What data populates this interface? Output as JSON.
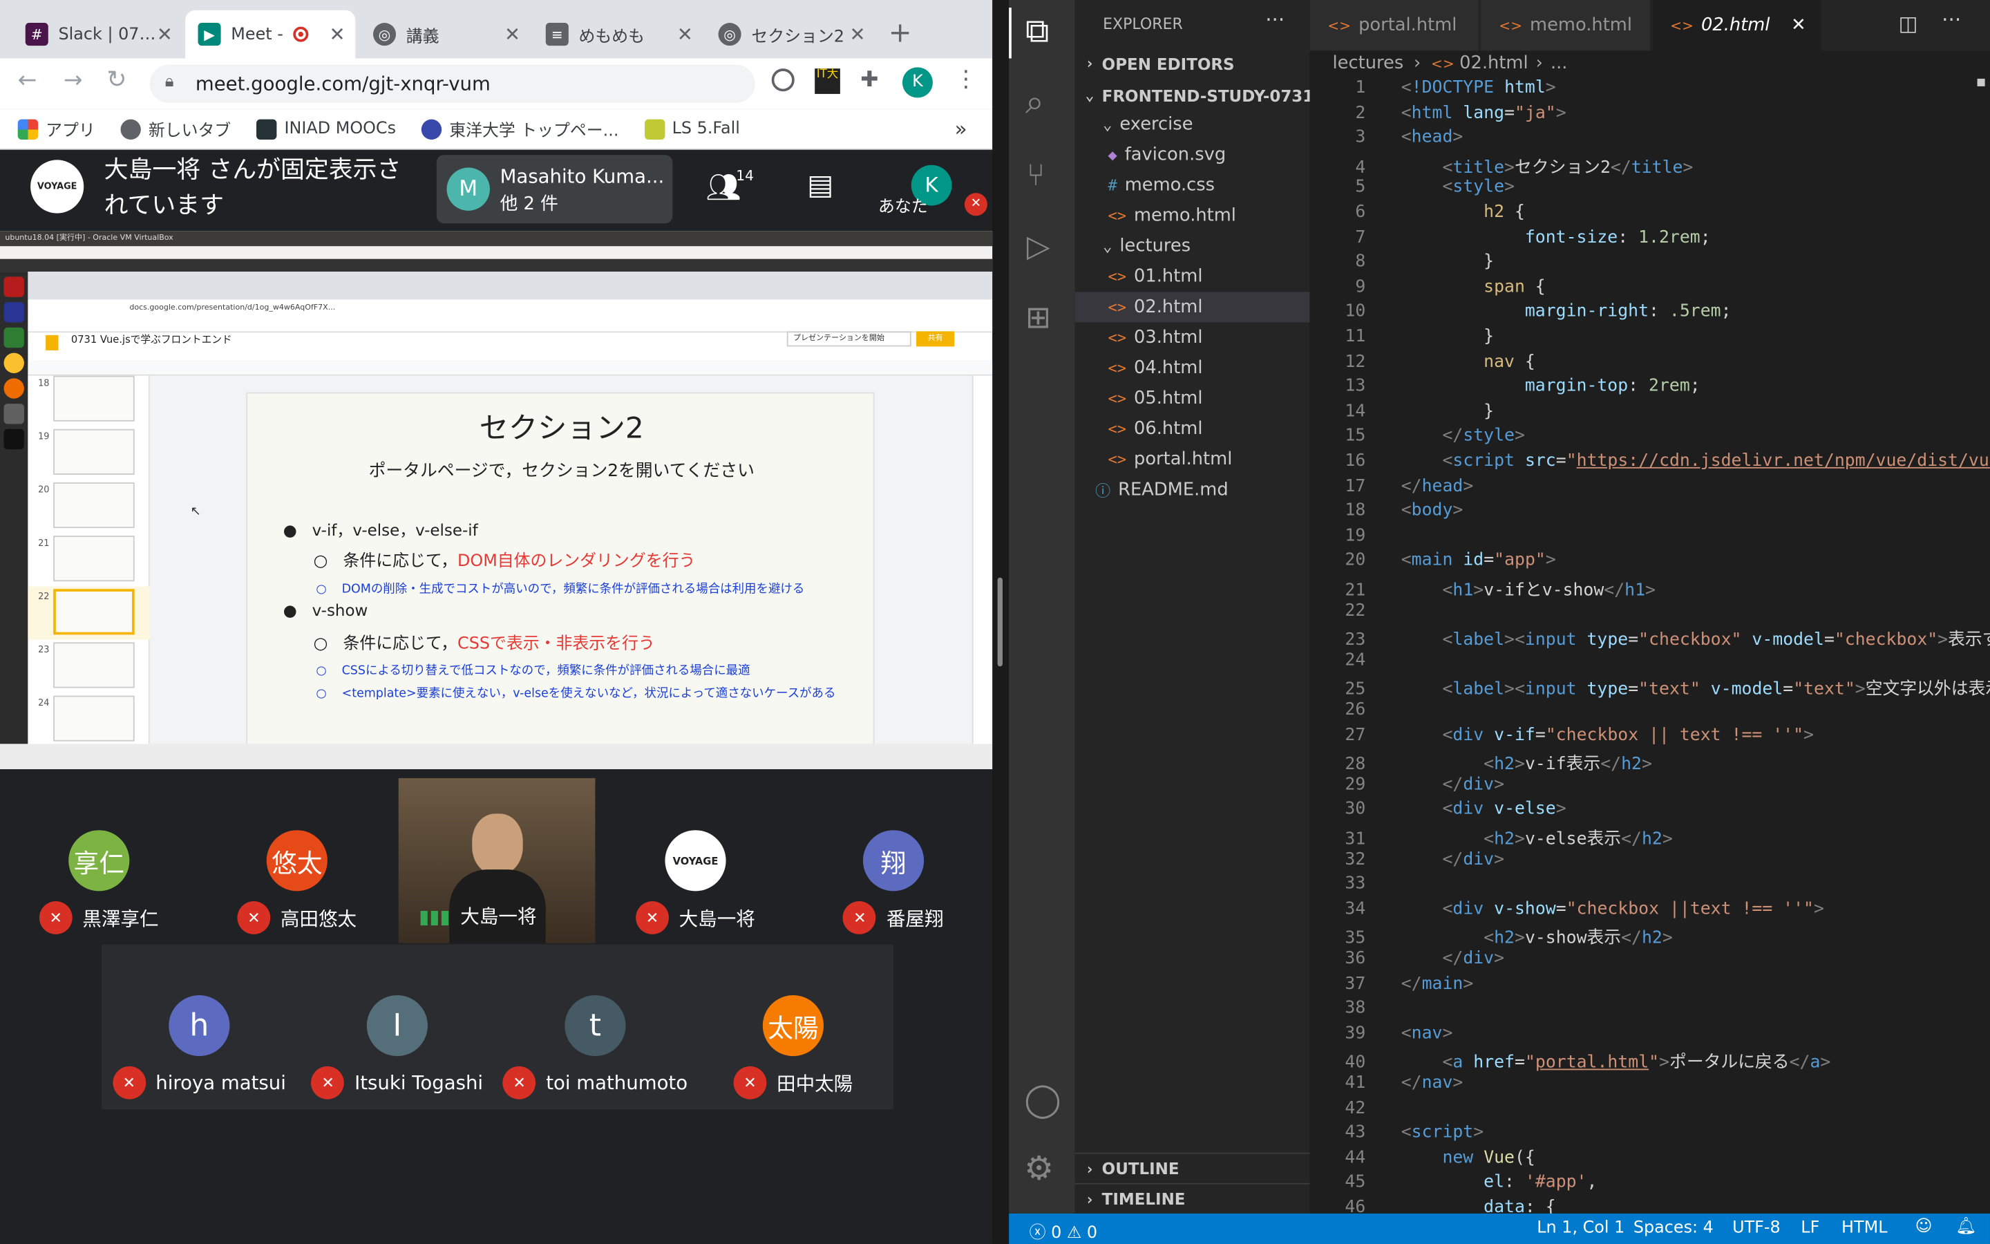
{
  "chrome": {
    "tabs": [
      {
        "label": "Slack | 07…"
      },
      {
        "label": "Meet -"
      },
      {
        "label": "講義"
      },
      {
        "label": "めもめも"
      },
      {
        "label": "セクション2"
      }
    ],
    "new_tab": "+",
    "url": "meet.google.com/gjt-xnqr-vum",
    "bookmarks": [
      {
        "label": "アプリ"
      },
      {
        "label": "新しいタブ"
      },
      {
        "label": "INIAD MOOCs"
      },
      {
        "label": "東洋大学 トップペー..."
      },
      {
        "label": "LS 5.Fall"
      }
    ],
    "more": "»"
  },
  "meet": {
    "pinned_text": "大島一将 さんが固定表示されています",
    "presenter_name": "Masahito Kuma...",
    "presenter_extra": "他 2 件",
    "people_count": "14",
    "self_label": "あなた",
    "self_initial": "K",
    "presenter_initial": "M",
    "participants_row1": [
      {
        "initial": "享仁",
        "name": "黒澤享仁",
        "color": "#7cb342"
      },
      {
        "initial": "悠太",
        "name": "高田悠太",
        "color": "#e64a19"
      },
      {
        "initial": "",
        "name": "大島一将",
        "video": true
      },
      {
        "initial": "VOYAGE",
        "name": "大島一将",
        "color": "#ffffff"
      },
      {
        "initial": "翔",
        "name": "番屋翔",
        "color": "#5c6bc0"
      }
    ],
    "participants_row2": [
      {
        "initial": "h",
        "name": "hiroya matsui",
        "color": "#5c6bc0"
      },
      {
        "initial": "I",
        "name": "Itsuki Togashi",
        "color": "#546e7a"
      },
      {
        "initial": "t",
        "name": "toi mathumoto",
        "color": "#455a64"
      },
      {
        "initial": "太陽",
        "name": "田中太陽",
        "color": "#f57c00"
      }
    ]
  },
  "slide": {
    "vm_title": "ubuntu18.04 [実行中] - Oracle VM VirtualBox",
    "doc_title": "0731 Vue.jsで学ぶフロントエンド",
    "url": "docs.google.com/presentation/d/1og_w4w6AqOfF7X...",
    "present_button": "プレゼンテーションを開始",
    "share_button": "共有",
    "title": "セクション2",
    "subtitle": "ポータルページで，セクション2を開いてください",
    "bullet1": "v-if，v-else，v-else-if",
    "sub1a_prefix": "条件に応じて，",
    "sub1a_red": "DOM自体のレンダリングを行う",
    "sub1b": "DOMの削除・生成でコストが高いので，頻繁に条件が評価される場合は利用を避ける",
    "bullet2": "v-show",
    "sub2a_prefix": "条件に応じて，",
    "sub2a_red": "CSSで表示・非表示を行う",
    "sub2b": "CSSによる切り替えで低コストなので，頻繁に条件が評価される場合に最適",
    "sub2c": "<template>要素に使えない，v-elseを使えないなど，状況によって適さないケースがある",
    "thumb_numbers": [
      "18",
      "19",
      "20",
      "21",
      "22",
      "23",
      "24"
    ]
  },
  "vscode": {
    "explorer_title": "EXPLORER",
    "open_editors": "OPEN EDITORS",
    "project": "FRONTEND-STUDY-0731",
    "tree": [
      {
        "label": "exercise",
        "type": "folder",
        "indent": 1
      },
      {
        "label": "favicon.svg",
        "type": "svg",
        "indent": 2
      },
      {
        "label": "memo.css",
        "type": "css",
        "indent": 2
      },
      {
        "label": "memo.html",
        "type": "html",
        "indent": 2
      },
      {
        "label": "lectures",
        "type": "folder",
        "indent": 1
      },
      {
        "label": "01.html",
        "type": "html",
        "indent": 2
      },
      {
        "label": "02.html",
        "type": "html",
        "indent": 2,
        "selected": true
      },
      {
        "label": "03.html",
        "type": "html",
        "indent": 2
      },
      {
        "label": "04.html",
        "type": "html",
        "indent": 2
      },
      {
        "label": "05.html",
        "type": "html",
        "indent": 2
      },
      {
        "label": "06.html",
        "type": "html",
        "indent": 2
      },
      {
        "label": "portal.html",
        "type": "html",
        "indent": 2
      },
      {
        "label": "README.md",
        "type": "md",
        "indent": 1
      }
    ],
    "outline": "OUTLINE",
    "timeline": "TIMELINE",
    "tabs": [
      {
        "label": "portal.html"
      },
      {
        "label": "memo.html"
      },
      {
        "label": "02.html",
        "active": true
      }
    ],
    "breadcrumb": [
      "lectures",
      "02.html",
      "..."
    ],
    "status": {
      "errors": "0",
      "warnings": "0",
      "position": "Ln 1, Col 1",
      "spaces": "Spaces: 4",
      "encoding": "UTF-8",
      "eol": "LF",
      "language": "HTML"
    }
  }
}
